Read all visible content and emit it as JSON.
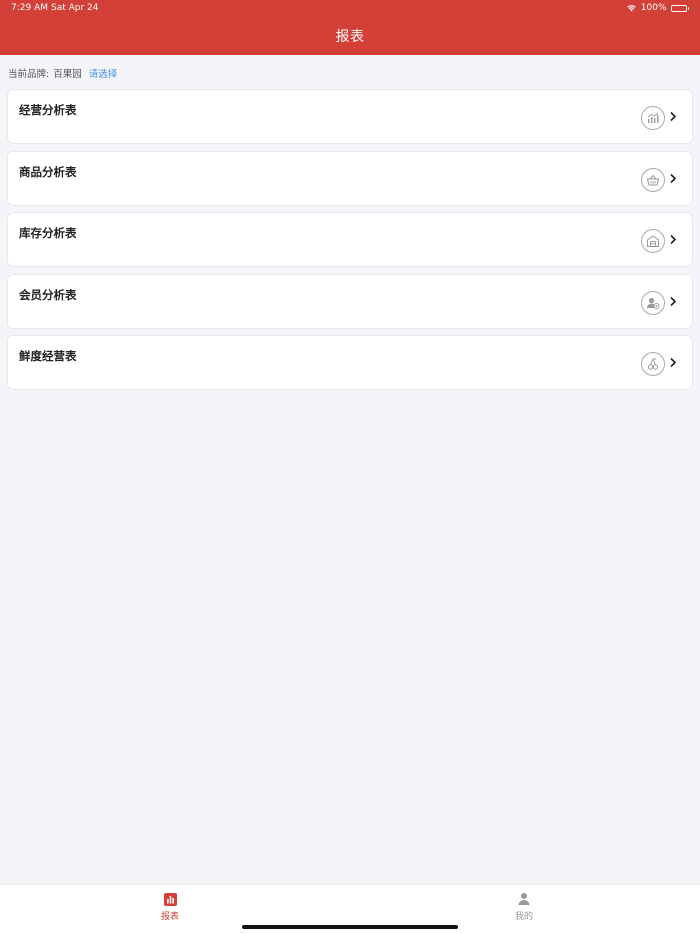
{
  "status_bar": {
    "time": "7:29 AM",
    "date": "Sat Apr 24",
    "battery": "100%"
  },
  "header": {
    "title": "报表"
  },
  "brand": {
    "label": "当前品牌:",
    "value": "百果园",
    "select_link": "请选择"
  },
  "cards": [
    {
      "title": "经营分析表",
      "icon": "bar-chart-icon"
    },
    {
      "title": "商品分析表",
      "icon": "basket-icon"
    },
    {
      "title": "库存分析表",
      "icon": "warehouse-icon"
    },
    {
      "title": "会员分析表",
      "icon": "member-icon"
    },
    {
      "title": "鲜度经营表",
      "icon": "cherry-icon"
    }
  ],
  "tabbar": {
    "tabs": [
      {
        "label": "报表",
        "icon": "chart-icon",
        "active": true
      },
      {
        "label": "我的",
        "icon": "person-icon",
        "active": false
      }
    ]
  },
  "colors": {
    "primary": "#d34037",
    "link": "#3a8ee6",
    "background": "#f4f5f9"
  }
}
